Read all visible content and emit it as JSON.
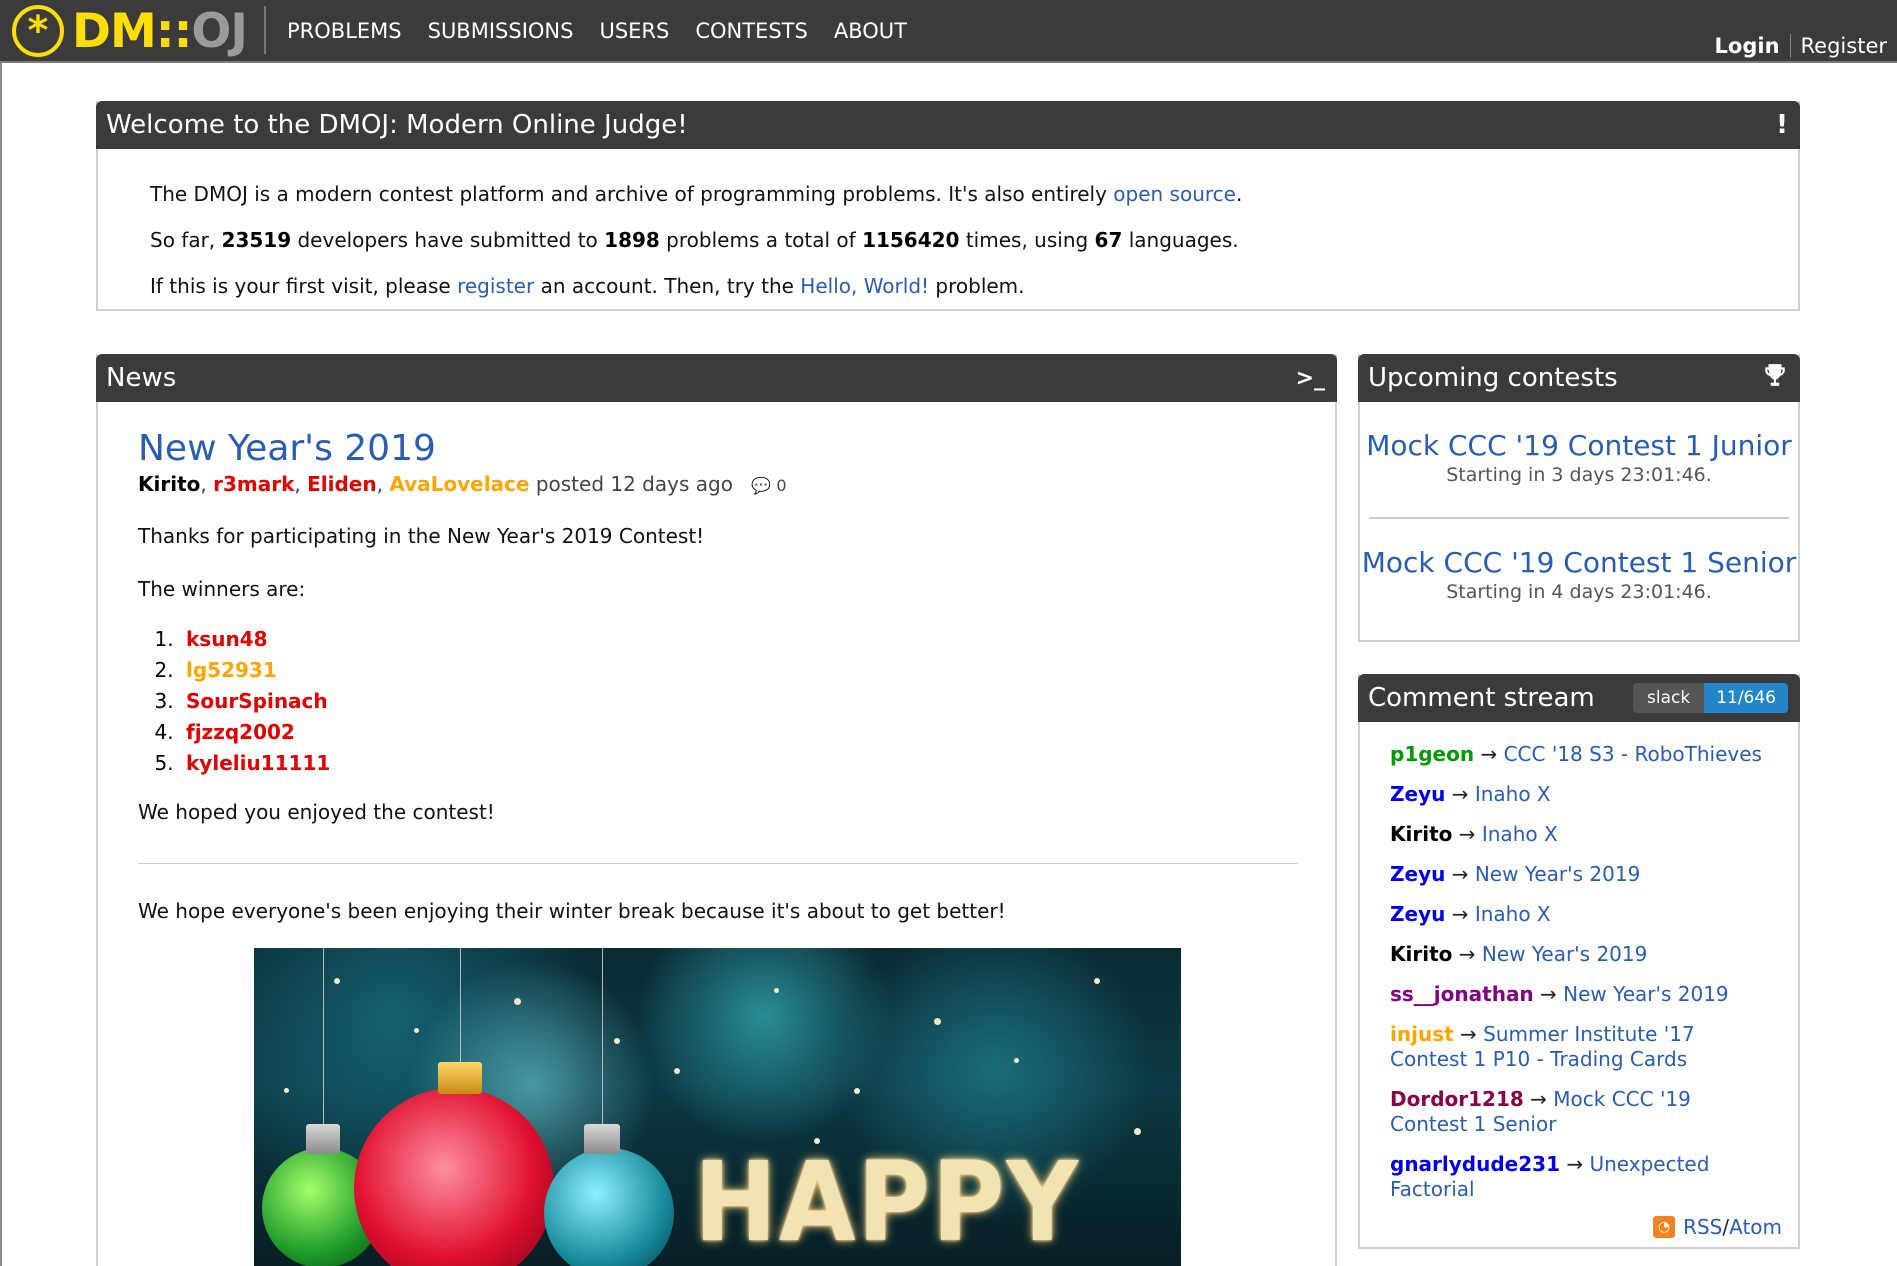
{
  "nav": {
    "logo_symbol": "*",
    "logo_dm": "DM",
    "logo_colon": "::",
    "logo_oj": "OJ",
    "items": [
      "PROBLEMS",
      "SUBMISSIONS",
      "USERS",
      "CONTESTS",
      "ABOUT"
    ],
    "login": "Login",
    "register": "Register"
  },
  "welcome": {
    "title": "Welcome to the DMOJ: Modern Online Judge!",
    "icon": "!",
    "line1_pre": "The DMOJ is a modern contest platform and archive of programming problems. It's also entirely ",
    "line1_link": "open source",
    "line1_post": ".",
    "line2_a": "So far, ",
    "developers": "23519",
    "line2_b": " developers have submitted to ",
    "problems": "1898",
    "line2_c": " problems a total of ",
    "submissions": "1156420",
    "line2_d": " times, using ",
    "languages": "67",
    "line2_e": " languages.",
    "line3_a": "If this is your first visit, please ",
    "line3_link1": "register",
    "line3_b": " an account. Then, try the ",
    "line3_link2": "Hello, World!",
    "line3_c": " problem."
  },
  "news": {
    "title": "News",
    "icon": ">_",
    "post": {
      "title": "New Year's 2019",
      "authors": [
        {
          "name": "Kirito",
          "color": "black"
        },
        {
          "name": "r3mark",
          "color": "red"
        },
        {
          "name": "Eliden",
          "color": "red"
        },
        {
          "name": "AvaLovelace",
          "color": "orange"
        }
      ],
      "author_sep": ", ",
      "posted": " posted 12 days ago",
      "comments": "0",
      "p1": "Thanks for participating in the New Year's 2019 Contest!",
      "p2": "The winners are:",
      "winners": [
        {
          "name": "ksun48",
          "color": "red"
        },
        {
          "name": "lg52931",
          "color": "orange"
        },
        {
          "name": "SourSpinach",
          "color": "red"
        },
        {
          "name": "fjzzq2002",
          "color": "red"
        },
        {
          "name": "kyleliu11111",
          "color": "red"
        }
      ],
      "p3": "We hoped you enjoyed the contest!",
      "p4": "We hope everyone's been enjoying their winter break because it's about to get better!",
      "banner_text": "HAPPY"
    }
  },
  "contests": {
    "title": "Upcoming contests",
    "icon": "trophy-icon",
    "items": [
      {
        "name": "Mock CCC '19 Contest 1 Junior",
        "time": "Starting in 3 days 23:01:46."
      },
      {
        "name": "Mock CCC '19 Contest 1 Senior",
        "time": "Starting in 4 days 23:01:46."
      }
    ]
  },
  "comments": {
    "title": "Comment stream",
    "slack_label": "slack",
    "slack_count": "11/646",
    "arrow": " → ",
    "items": [
      {
        "user": "p1geon",
        "color": "green",
        "target": "CCC '18 S3 - RoboThieves"
      },
      {
        "user": "Zeyu",
        "color": "blue",
        "target": "Inaho X"
      },
      {
        "user": "Kirito",
        "color": "black",
        "target": "Inaho X"
      },
      {
        "user": "Zeyu",
        "color": "blue",
        "target": "New Year's 2019"
      },
      {
        "user": "Zeyu",
        "color": "blue",
        "target": "Inaho X"
      },
      {
        "user": "Kirito",
        "color": "black",
        "target": "New Year's 2019"
      },
      {
        "user": "ss__jonathan",
        "color": "purple",
        "target": "New Year's 2019"
      },
      {
        "user": "injust",
        "color": "orange",
        "target": "Summer Institute '17 Contest 1 P10 - Trading Cards"
      },
      {
        "user": "Dordor1218",
        "color": "maroon",
        "target": "Mock CCC '19 Contest 1 Senior"
      },
      {
        "user": "gnarlydude231",
        "color": "blue",
        "target": "Unexpected Factorial"
      }
    ],
    "rss": "RSS",
    "feed_sep": " / ",
    "atom": "Atom"
  },
  "colors": {
    "nav_bg": "#3b3b3b",
    "logo_yellow": "#ffde05",
    "link_blue": "#2a5db0",
    "user_red": "#e00000",
    "user_orange": "#ffa500",
    "slack_blue": "#2386c8"
  }
}
